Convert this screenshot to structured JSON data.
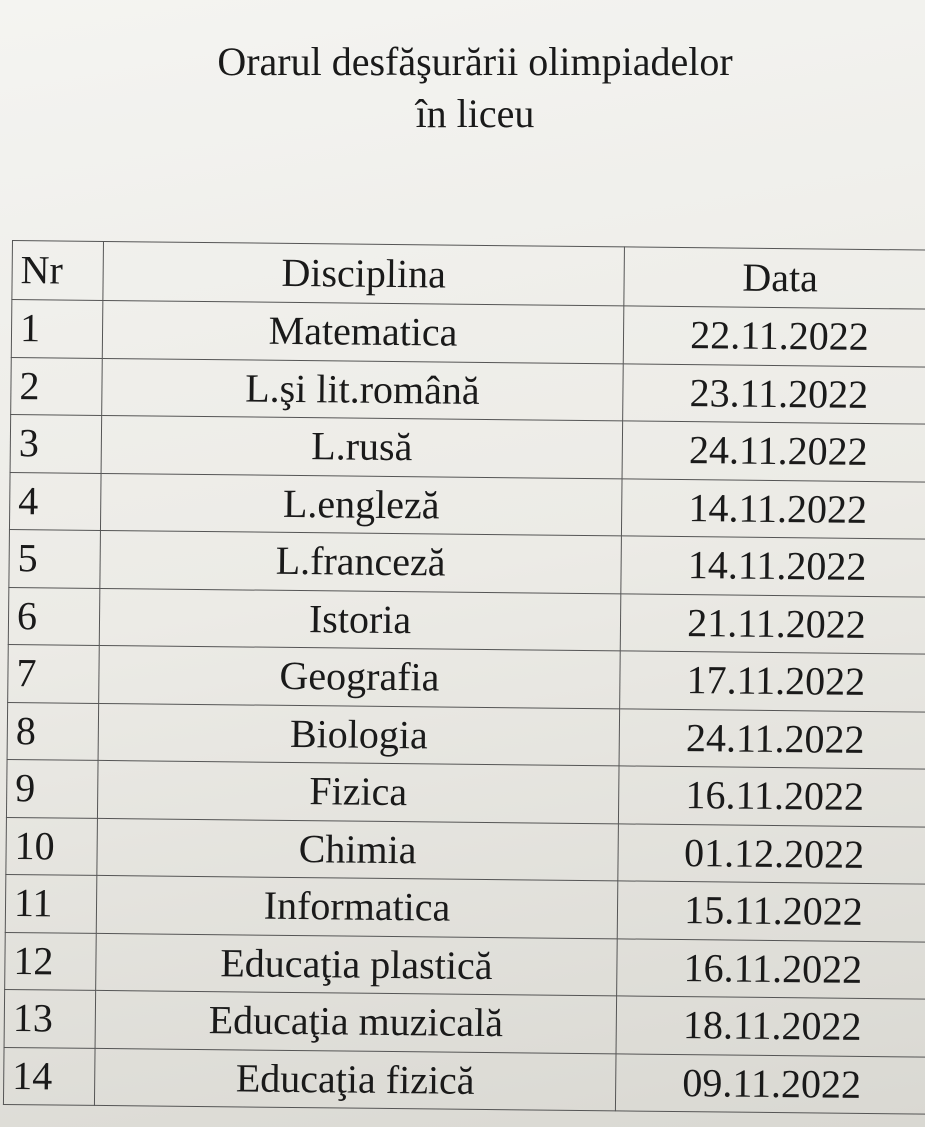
{
  "title": {
    "line1": "Orarul desfăşurării olimpiadelor",
    "line2": "în liceu"
  },
  "table": {
    "headers": [
      "Nr",
      "Disciplina",
      "Data"
    ],
    "rows": [
      [
        "1",
        "Matematica",
        "22.11.2022"
      ],
      [
        "2",
        "L.şi lit.română",
        "23.11.2022"
      ],
      [
        "3",
        "L.rusă",
        "24.11.2022"
      ],
      [
        "4",
        "L.engleză",
        "14.11.2022"
      ],
      [
        "5",
        "L.franceză",
        "14.11.2022"
      ],
      [
        "6",
        "Istoria",
        "21.11.2022"
      ],
      [
        "7",
        "Geografia",
        "17.11.2022"
      ],
      [
        "8",
        "Biologia",
        "24.11.2022"
      ],
      [
        "9",
        "Fizica",
        "16.11.2022"
      ],
      [
        "10",
        "Chimia",
        "01.12.2022"
      ],
      [
        "11",
        "Informatica",
        "15.11.2022"
      ],
      [
        "12",
        "Educaţia plastică",
        "16.11.2022"
      ],
      [
        "13",
        "Educaţia muzicală",
        "18.11.2022"
      ],
      [
        "14",
        "Educaţia fizică",
        "09.11.2022"
      ]
    ]
  }
}
